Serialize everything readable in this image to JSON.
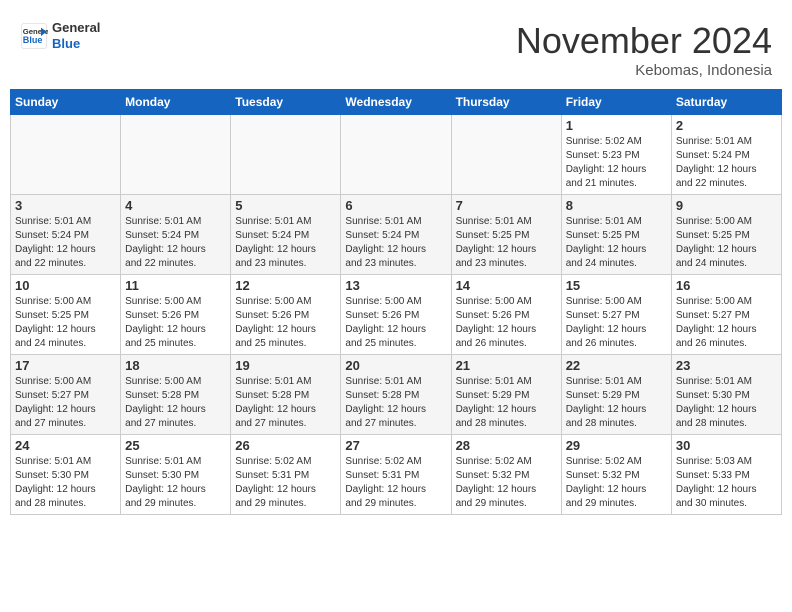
{
  "header": {
    "logo_line1": "General",
    "logo_line2": "Blue",
    "month": "November 2024",
    "location": "Kebomas, Indonesia"
  },
  "weekdays": [
    "Sunday",
    "Monday",
    "Tuesday",
    "Wednesday",
    "Thursday",
    "Friday",
    "Saturday"
  ],
  "weeks": [
    [
      {
        "day": "",
        "info": ""
      },
      {
        "day": "",
        "info": ""
      },
      {
        "day": "",
        "info": ""
      },
      {
        "day": "",
        "info": ""
      },
      {
        "day": "",
        "info": ""
      },
      {
        "day": "1",
        "info": "Sunrise: 5:02 AM\nSunset: 5:23 PM\nDaylight: 12 hours\nand 21 minutes."
      },
      {
        "day": "2",
        "info": "Sunrise: 5:01 AM\nSunset: 5:24 PM\nDaylight: 12 hours\nand 22 minutes."
      }
    ],
    [
      {
        "day": "3",
        "info": "Sunrise: 5:01 AM\nSunset: 5:24 PM\nDaylight: 12 hours\nand 22 minutes."
      },
      {
        "day": "4",
        "info": "Sunrise: 5:01 AM\nSunset: 5:24 PM\nDaylight: 12 hours\nand 22 minutes."
      },
      {
        "day": "5",
        "info": "Sunrise: 5:01 AM\nSunset: 5:24 PM\nDaylight: 12 hours\nand 23 minutes."
      },
      {
        "day": "6",
        "info": "Sunrise: 5:01 AM\nSunset: 5:24 PM\nDaylight: 12 hours\nand 23 minutes."
      },
      {
        "day": "7",
        "info": "Sunrise: 5:01 AM\nSunset: 5:25 PM\nDaylight: 12 hours\nand 23 minutes."
      },
      {
        "day": "8",
        "info": "Sunrise: 5:01 AM\nSunset: 5:25 PM\nDaylight: 12 hours\nand 24 minutes."
      },
      {
        "day": "9",
        "info": "Sunrise: 5:00 AM\nSunset: 5:25 PM\nDaylight: 12 hours\nand 24 minutes."
      }
    ],
    [
      {
        "day": "10",
        "info": "Sunrise: 5:00 AM\nSunset: 5:25 PM\nDaylight: 12 hours\nand 24 minutes."
      },
      {
        "day": "11",
        "info": "Sunrise: 5:00 AM\nSunset: 5:26 PM\nDaylight: 12 hours\nand 25 minutes."
      },
      {
        "day": "12",
        "info": "Sunrise: 5:00 AM\nSunset: 5:26 PM\nDaylight: 12 hours\nand 25 minutes."
      },
      {
        "day": "13",
        "info": "Sunrise: 5:00 AM\nSunset: 5:26 PM\nDaylight: 12 hours\nand 25 minutes."
      },
      {
        "day": "14",
        "info": "Sunrise: 5:00 AM\nSunset: 5:26 PM\nDaylight: 12 hours\nand 26 minutes."
      },
      {
        "day": "15",
        "info": "Sunrise: 5:00 AM\nSunset: 5:27 PM\nDaylight: 12 hours\nand 26 minutes."
      },
      {
        "day": "16",
        "info": "Sunrise: 5:00 AM\nSunset: 5:27 PM\nDaylight: 12 hours\nand 26 minutes."
      }
    ],
    [
      {
        "day": "17",
        "info": "Sunrise: 5:00 AM\nSunset: 5:27 PM\nDaylight: 12 hours\nand 27 minutes."
      },
      {
        "day": "18",
        "info": "Sunrise: 5:00 AM\nSunset: 5:28 PM\nDaylight: 12 hours\nand 27 minutes."
      },
      {
        "day": "19",
        "info": "Sunrise: 5:01 AM\nSunset: 5:28 PM\nDaylight: 12 hours\nand 27 minutes."
      },
      {
        "day": "20",
        "info": "Sunrise: 5:01 AM\nSunset: 5:28 PM\nDaylight: 12 hours\nand 27 minutes."
      },
      {
        "day": "21",
        "info": "Sunrise: 5:01 AM\nSunset: 5:29 PM\nDaylight: 12 hours\nand 28 minutes."
      },
      {
        "day": "22",
        "info": "Sunrise: 5:01 AM\nSunset: 5:29 PM\nDaylight: 12 hours\nand 28 minutes."
      },
      {
        "day": "23",
        "info": "Sunrise: 5:01 AM\nSunset: 5:30 PM\nDaylight: 12 hours\nand 28 minutes."
      }
    ],
    [
      {
        "day": "24",
        "info": "Sunrise: 5:01 AM\nSunset: 5:30 PM\nDaylight: 12 hours\nand 28 minutes."
      },
      {
        "day": "25",
        "info": "Sunrise: 5:01 AM\nSunset: 5:30 PM\nDaylight: 12 hours\nand 29 minutes."
      },
      {
        "day": "26",
        "info": "Sunrise: 5:02 AM\nSunset: 5:31 PM\nDaylight: 12 hours\nand 29 minutes."
      },
      {
        "day": "27",
        "info": "Sunrise: 5:02 AM\nSunset: 5:31 PM\nDaylight: 12 hours\nand 29 minutes."
      },
      {
        "day": "28",
        "info": "Sunrise: 5:02 AM\nSunset: 5:32 PM\nDaylight: 12 hours\nand 29 minutes."
      },
      {
        "day": "29",
        "info": "Sunrise: 5:02 AM\nSunset: 5:32 PM\nDaylight: 12 hours\nand 29 minutes."
      },
      {
        "day": "30",
        "info": "Sunrise: 5:03 AM\nSunset: 5:33 PM\nDaylight: 12 hours\nand 30 minutes."
      }
    ]
  ]
}
